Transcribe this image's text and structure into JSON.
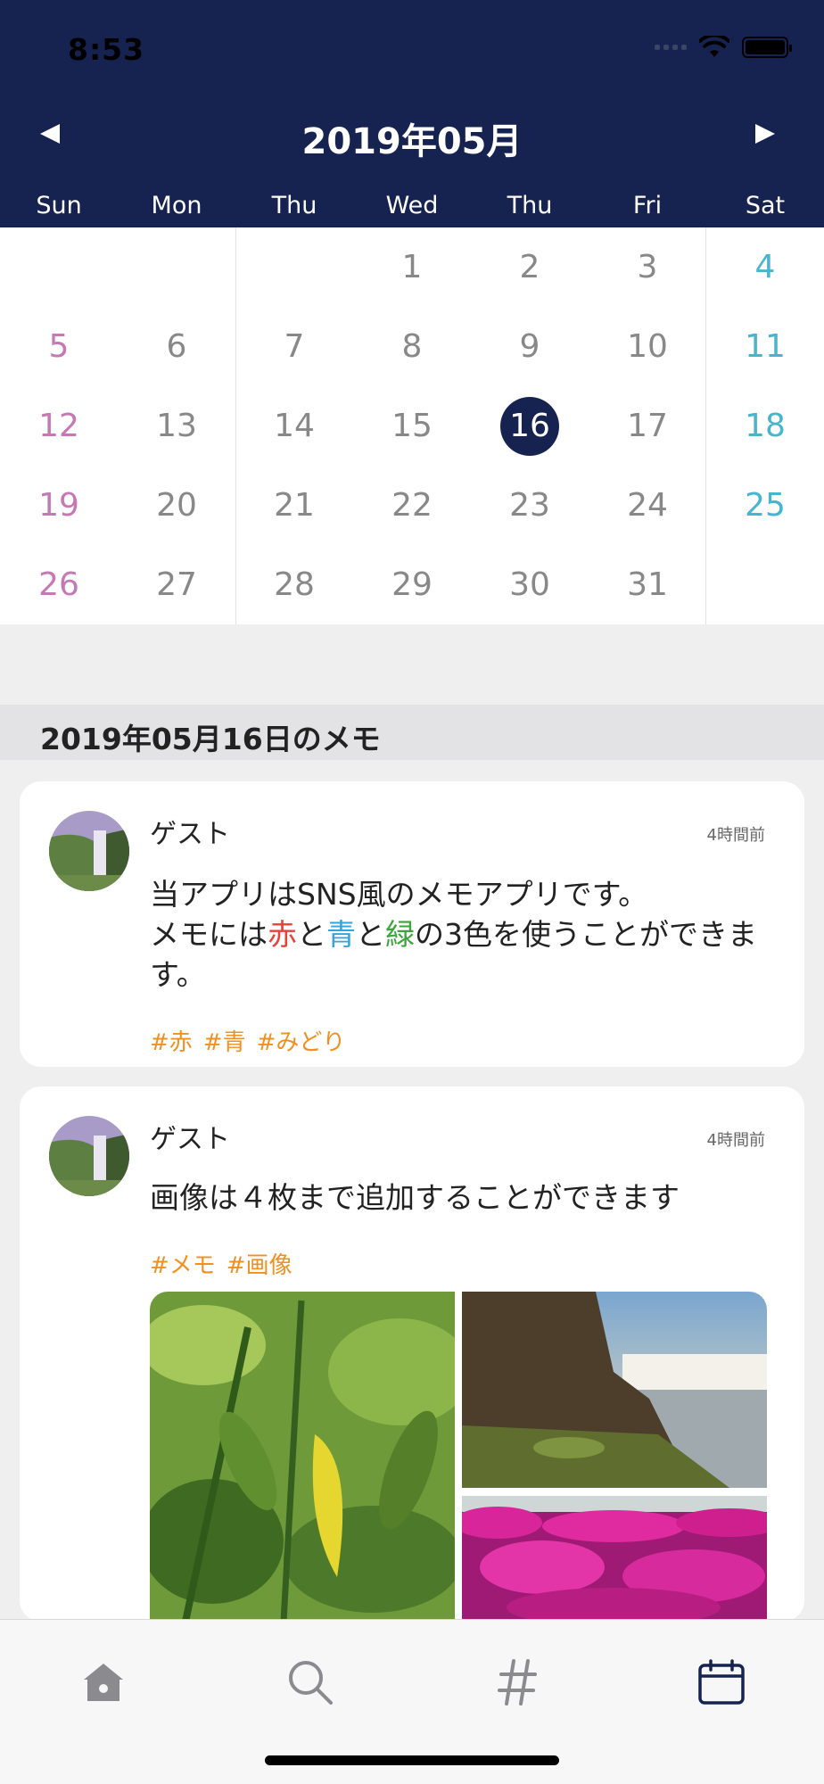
{
  "status": {
    "time": "8:53"
  },
  "calendar": {
    "title": "2019年05月",
    "weekdays": [
      "Sun",
      "Mon",
      "Thu",
      "Wed",
      "Thu",
      "Fri",
      "Sat"
    ],
    "weeks": [
      [
        "",
        "",
        "",
        "1",
        "2",
        "3",
        "4"
      ],
      [
        "5",
        "6",
        "7",
        "8",
        "9",
        "10",
        "11"
      ],
      [
        "12",
        "13",
        "14",
        "15",
        "16",
        "17",
        "18"
      ],
      [
        "19",
        "20",
        "21",
        "22",
        "23",
        "24",
        "25"
      ],
      [
        "26",
        "27",
        "28",
        "29",
        "30",
        "31",
        ""
      ]
    ],
    "selected_day": "16"
  },
  "section": {
    "title": "2019年05月16日のメモ"
  },
  "memos": [
    {
      "name": "ゲスト",
      "time": "4時間前",
      "body": {
        "line1": " 当アプリはSNS風のメモアプリです。",
        "pre": "メモには",
        "red": "赤",
        "and1": "と",
        "blue": "青",
        "and2": "と",
        "green": "緑",
        "post": "の3色を使うことができます。"
      },
      "tags": [
        "#赤",
        "#青",
        "#みどり"
      ]
    },
    {
      "name": "ゲスト",
      "time": "4時間前",
      "body": "画像は４枚まで追加することができます",
      "tags": [
        "#メモ",
        "#画像"
      ]
    }
  ],
  "tabbar": {
    "items": [
      "home-icon",
      "search-icon",
      "hashtag-icon",
      "calendar-icon"
    ],
    "active": "calendar-icon"
  },
  "colors": {
    "header": "#162350",
    "sunday": "#c678b6",
    "saturday": "#48b5cf",
    "tag": "#f09020"
  }
}
